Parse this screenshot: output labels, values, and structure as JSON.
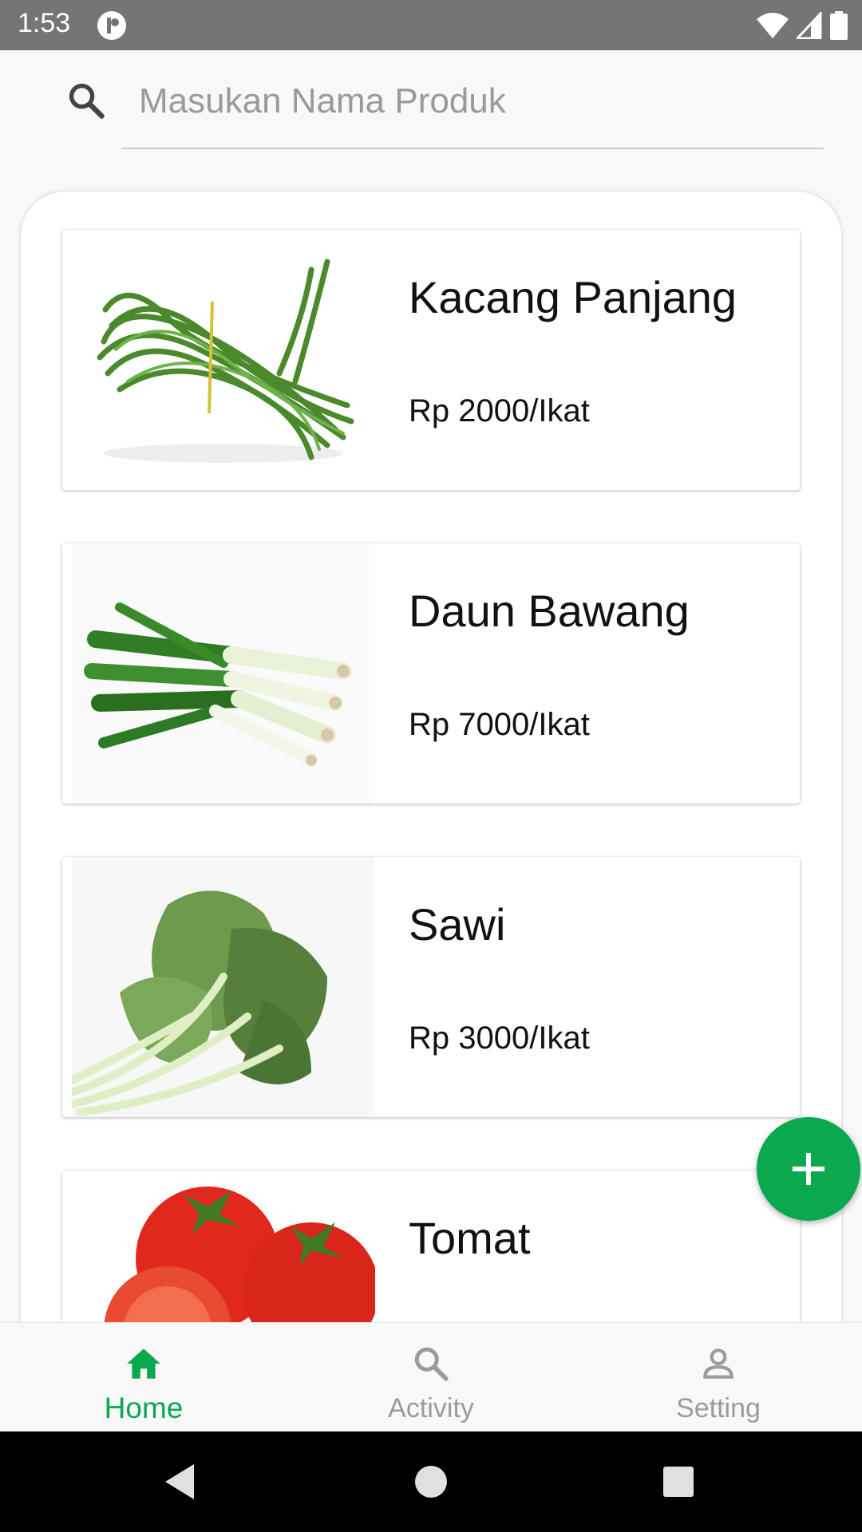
{
  "status_bar": {
    "time": "1:53",
    "icons": [
      "app-notification-icon",
      "wifi-icon",
      "signal-icon",
      "battery-icon"
    ]
  },
  "search": {
    "placeholder": "Masukan Nama Produk",
    "value": "",
    "icon": "search-icon"
  },
  "products": [
    {
      "name": "Kacang Panjang",
      "price": "Rp 2000/Ikat",
      "image": "long-beans-image"
    },
    {
      "name": "Daun Bawang",
      "price": "Rp 7000/Ikat",
      "image": "spring-onion-image"
    },
    {
      "name": "Sawi",
      "price": "Rp 3000/Ikat",
      "image": "mustard-greens-image"
    },
    {
      "name": "Tomat",
      "price": "",
      "image": "tomato-image"
    }
  ],
  "fab": {
    "icon": "plus-icon"
  },
  "bottom_nav": {
    "items": [
      {
        "label": "Home",
        "icon": "home-icon",
        "active": true
      },
      {
        "label": "Activity",
        "icon": "search-icon",
        "active": false
      },
      {
        "label": "Setting",
        "icon": "person-icon",
        "active": false
      }
    ]
  },
  "colors": {
    "accent": "#0aa84f",
    "status_bar": "#757575",
    "inactive": "#9b9b9b",
    "background": "#f8f8f8"
  }
}
